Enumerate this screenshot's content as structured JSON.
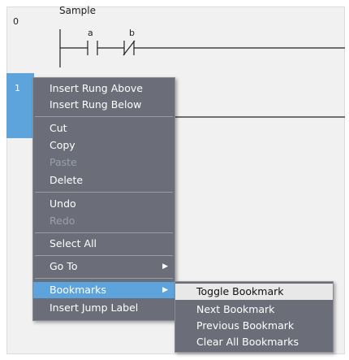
{
  "rungs": [
    {
      "number": "0",
      "comment": "Sample",
      "contacts": [
        "a",
        "b"
      ]
    },
    {
      "number": "1"
    }
  ],
  "context_menu": {
    "items": [
      {
        "label": "Insert Rung Above",
        "enabled": true
      },
      {
        "label": "Insert Rung Below",
        "enabled": true
      },
      {
        "label": "Cut",
        "enabled": true
      },
      {
        "label": "Copy",
        "enabled": true
      },
      {
        "label": "Paste",
        "enabled": false
      },
      {
        "label": "Delete",
        "enabled": true
      },
      {
        "label": "Undo",
        "enabled": true
      },
      {
        "label": "Redo",
        "enabled": false
      },
      {
        "label": "Select All",
        "enabled": true
      },
      {
        "label": "Go To",
        "enabled": true,
        "has_submenu": true
      },
      {
        "label": "Bookmarks",
        "enabled": true,
        "has_submenu": true,
        "highlighted": true
      },
      {
        "label": "Insert Jump Label",
        "enabled": true
      }
    ]
  },
  "bookmarks_submenu": {
    "items": [
      {
        "label": "Toggle Bookmark",
        "highlighted": true
      },
      {
        "label": "Next Bookmark"
      },
      {
        "label": "Previous Bookmark"
      },
      {
        "label": "Clear All Bookmarks"
      }
    ]
  },
  "colors": {
    "menu_bg": "#6b6e78",
    "highlight": "#5ea4dc",
    "editor_bg": "#f1f1f1"
  },
  "icons": {
    "submenu_arrow": "triangle-right-icon"
  }
}
